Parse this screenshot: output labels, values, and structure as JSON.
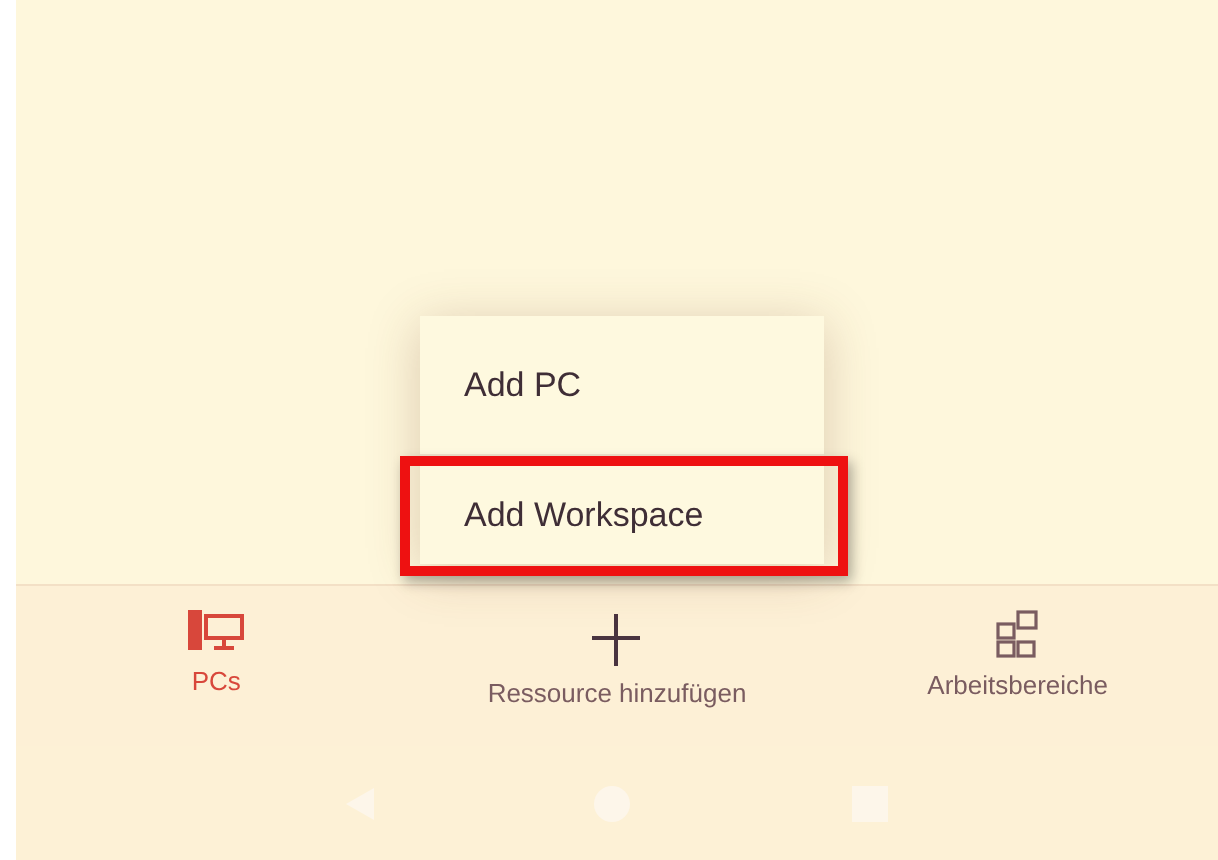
{
  "menu": {
    "items": [
      {
        "label": "Add PC",
        "highlighted": false
      },
      {
        "label": "Add Workspace",
        "highlighted": true
      }
    ]
  },
  "bottom_nav": {
    "items": [
      {
        "label": "PCs",
        "kind": "pcs",
        "selected": true
      },
      {
        "label": "Ressource hinzufügen",
        "kind": "add",
        "selected": false
      },
      {
        "label": "Arbeitsbereiche",
        "kind": "workspaces",
        "selected": false
      }
    ]
  }
}
